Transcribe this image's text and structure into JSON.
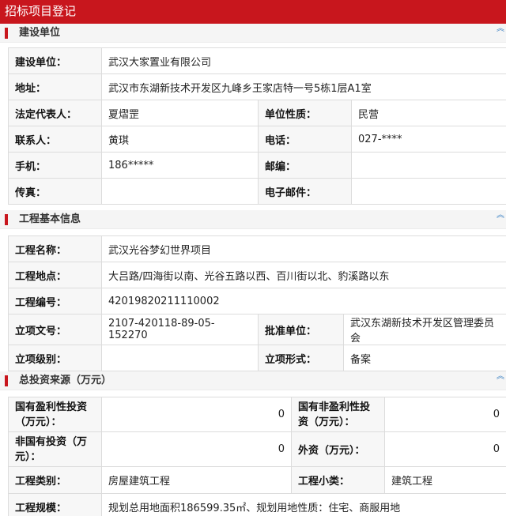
{
  "page_title": "招标项目登记",
  "collapse_glyph": "︽",
  "sections": {
    "builder": {
      "title": "建设单位",
      "unit_label": "建设单位：",
      "unit_value": "武汉大家置业有限公司",
      "address_label": "地址：",
      "address_value": "武汉市东湖新技术开发区九峰乡王家店特一号5栋1层A1室",
      "legal_rep_label": "法定代表人：",
      "legal_rep_value": "夏熠罡",
      "nature_label": "单位性质：",
      "nature_value": "民营",
      "contact_label": "联系人：",
      "contact_value": "黄琪",
      "phone_label": "电话：",
      "phone_value": "027-****",
      "mobile_label": "手机：",
      "mobile_value": "186*****",
      "postcode_label": "邮编：",
      "postcode_value": "",
      "fax_label": "传真：",
      "fax_value": "",
      "email_label": "电子邮件：",
      "email_value": ""
    },
    "project": {
      "title": "工程基本信息",
      "name_label": "工程名称：",
      "name_value": "武汉光谷梦幻世界项目",
      "location_label": "工程地点：",
      "location_value": "大吕路/四海街以南、光谷五路以西、百川街以北、豹溪路以东",
      "code_label": "工程编号：",
      "code_value": "42019820211110002",
      "approval_no_label": "立项文号：",
      "approval_no_value": "2107-420118-89-05-152270",
      "approver_label": "批准单位：",
      "approver_value": "武汉东湖新技术开发区管理委员会",
      "level_label": "立项级别：",
      "level_value": "",
      "form_label": "立项形式：",
      "form_value": "备案"
    },
    "investment": {
      "title": "总投资来源（万元）",
      "state_profit_label": "国有盈利性投资（万元）：",
      "state_profit_value": "0",
      "state_nonprofit_label": "国有非盈利性投资（万元）：",
      "state_nonprofit_value": "0",
      "non_state_label": "非国有投资（万元）：",
      "non_state_value": "0",
      "foreign_label": "外资（万元）：",
      "foreign_value": "0",
      "category_label": "工程类别：",
      "category_value": "房屋建筑工程",
      "subcategory_label": "工程小类：",
      "subcategory_value": "建筑工程",
      "scale_label": "工程规模：",
      "scale_value": "规划总用地面积186599.35㎡、规划用地性质：住宅、商服用地"
    }
  }
}
